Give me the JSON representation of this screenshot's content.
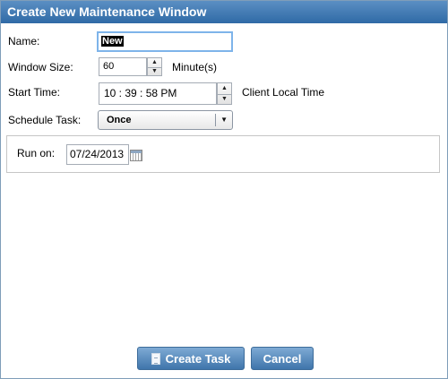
{
  "dialog": {
    "title": "Create New Maintenance Window"
  },
  "form": {
    "name_label": "Name:",
    "name_value": "New",
    "window_size_label": "Window Size:",
    "window_size_value": "60",
    "window_size_unit": "Minute(s)",
    "start_time_label": "Start Time:",
    "start_time_value": "10 : 39 : 58 PM",
    "start_time_zone": "Client Local Time",
    "schedule_label": "Schedule Task:",
    "schedule_value": "Once",
    "run_on_label": "Run on:",
    "run_on_value": "07/24/2013"
  },
  "buttons": {
    "create_task": "Create Task",
    "cancel": "Cancel"
  },
  "icons": {
    "spin_up": "up-arrow-icon",
    "spin_down": "down-arrow-icon",
    "dropdown": "chevron-down-icon",
    "calendar": "calendar-icon",
    "create_task": "document-icon"
  }
}
